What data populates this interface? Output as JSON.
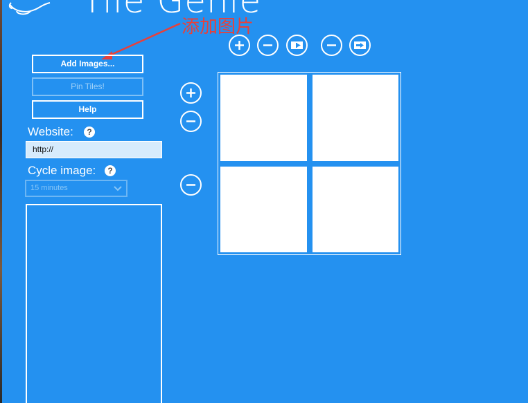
{
  "app": {
    "title": "Tile Genie"
  },
  "annotation": {
    "text": "添加图片",
    "color": "#e8403a"
  },
  "buttons": {
    "add_images": "Add Images...",
    "pin_tiles": "Pin Tiles!",
    "help": "Help"
  },
  "website": {
    "label": "Website:",
    "value": "http://"
  },
  "cycle": {
    "label": "Cycle image:",
    "selected": "15 minutes"
  },
  "help_glyph": "?",
  "toolbar": {
    "icons": [
      "add-column-icon",
      "remove-column-icon",
      "swap-column-icon",
      "remove-column-icon",
      "swap-column-icon"
    ]
  },
  "side_controls": {
    "icons": [
      "add-row-icon",
      "remove-row-icon",
      "remove-row-icon"
    ]
  },
  "tiles": {
    "rows": 2,
    "columns": 2
  },
  "colors": {
    "background": "#2491f0",
    "foreground": "#ffffff",
    "input_background": "#d6ebfc"
  }
}
